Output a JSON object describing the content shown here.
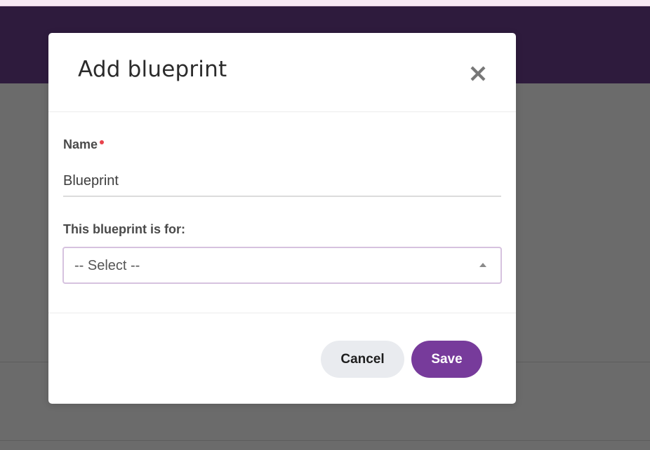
{
  "modal": {
    "title": "Add blueprint",
    "name_label": "Name",
    "name_value": "Blueprint",
    "for_label": "This blueprint is for:",
    "select_value": "-- Select --",
    "cancel_label": "Cancel",
    "save_label": "Save"
  },
  "icons": {
    "close": "close-icon",
    "select_caret": "caret-up-icon",
    "required": "required-indicator-dot"
  },
  "colors": {
    "header_bg": "#2e1b3d",
    "overlay": "#6b6b6b",
    "primary": "#773b9b",
    "required": "#e8434c",
    "select_border": "#d6c2df",
    "cancel_bg": "#e9ebef"
  }
}
